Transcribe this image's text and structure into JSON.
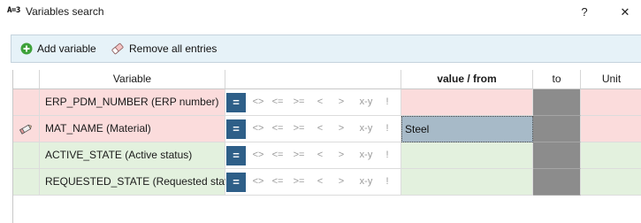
{
  "window": {
    "icon_text": "A=3",
    "title": "Variables search",
    "help_label": "?",
    "close_label": "✕"
  },
  "toolbar": {
    "add_label": "Add variable",
    "remove_label": "Remove all entries"
  },
  "grid": {
    "columns": [
      "Variable",
      "value / from",
      "to",
      "Unit"
    ],
    "operators": [
      "<>",
      "<=",
      ">=",
      "<",
      ">",
      "x-y",
      "!"
    ],
    "equals_label": "=",
    "rows": [
      {
        "variable": "ERP_PDM_NUMBER (ERP number)",
        "value": "",
        "color": "#fbdcdc"
      },
      {
        "variable": "MAT_NAME (Material)",
        "value": "Steel",
        "color": "#fbdcdc",
        "editing": true
      },
      {
        "variable": "ACTIVE_STATE (Active status)",
        "value": "",
        "color": "#e3f1de"
      },
      {
        "variable": "REQUESTED_STATE (Requested status)",
        "value": "",
        "color": "#e3f1de"
      }
    ]
  },
  "colors": {
    "toolbar_bg": "#e6f2f8",
    "pink_row": "#fbdcdc",
    "green_row": "#e3f1de",
    "equals_button": "#2e5f88",
    "to_column_disabled": "#8c8c8c",
    "selected_value": "#a7bac8"
  }
}
